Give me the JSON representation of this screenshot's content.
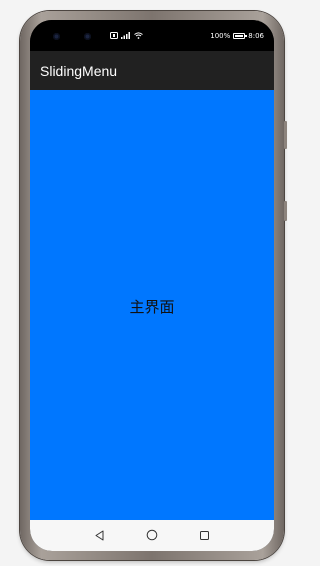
{
  "status_bar": {
    "battery_text": "100%",
    "time": "8:06",
    "battery_level": 1.0
  },
  "action_bar": {
    "title": "SlidingMenu"
  },
  "main": {
    "label": "主界面",
    "background_color": "#0077ff"
  },
  "nav_bar": {
    "back_icon": "back-triangle",
    "home_icon": "home-circle",
    "recents_icon": "recents-square"
  }
}
